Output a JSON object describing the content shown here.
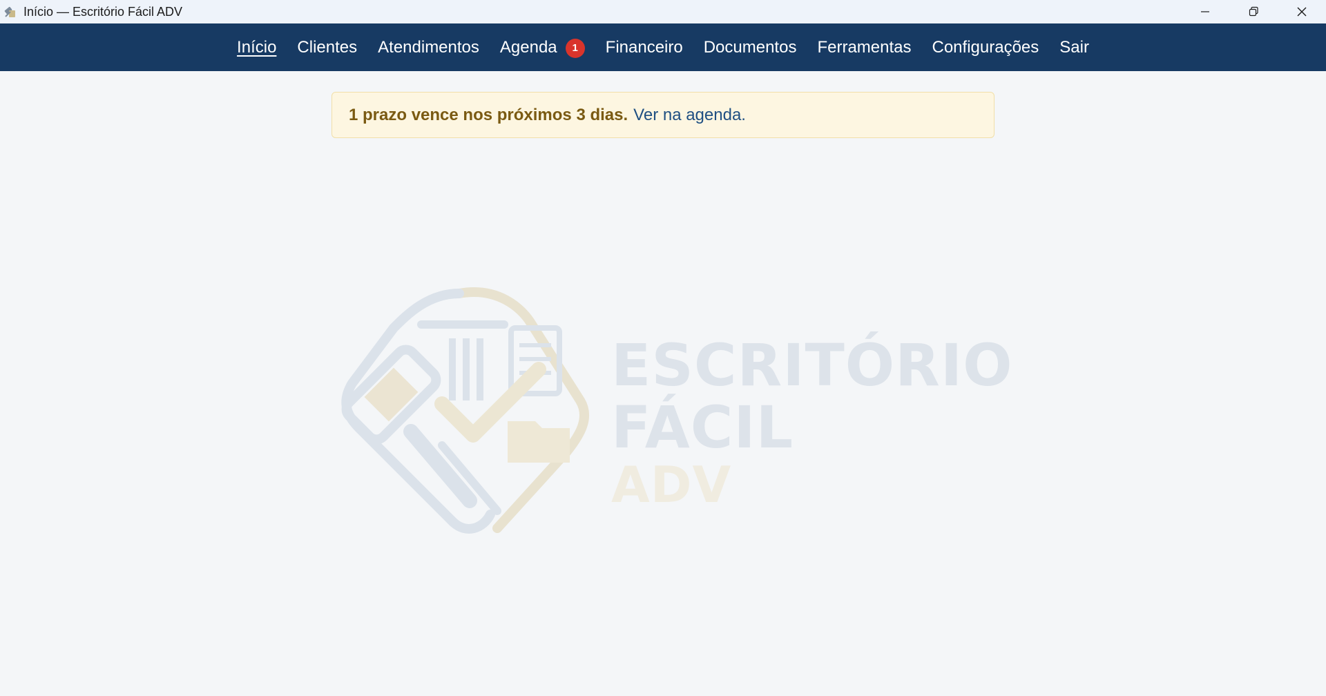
{
  "window": {
    "title": "Início — Escritório Fácil ADV",
    "app_icon": "scales-logo-icon",
    "controls": [
      "minimize-icon",
      "restore-icon",
      "close-icon"
    ]
  },
  "nav": {
    "items": [
      {
        "label": "Início",
        "active": true
      },
      {
        "label": "Clientes"
      },
      {
        "label": "Atendimentos"
      },
      {
        "label": "Agenda",
        "badge": "1"
      },
      {
        "label": "Financeiro"
      },
      {
        "label": "Documentos"
      },
      {
        "label": "Ferramentas"
      },
      {
        "label": "Configurações"
      },
      {
        "label": "Sair"
      }
    ],
    "background": "#173a63",
    "badge_color": "#d9342b"
  },
  "alert": {
    "message": "1 prazo vence nos próximos 3 dias.",
    "link": "Ver na agenda."
  },
  "watermark": {
    "line1": "ESCRITÓRIO",
    "line2": "FÁCIL",
    "line3": "ADV"
  },
  "colors": {
    "page_background": "#f4f6f8",
    "alert_background": "#fdf6e1",
    "alert_text": "#7a5a12",
    "link": "#1f4f82"
  }
}
